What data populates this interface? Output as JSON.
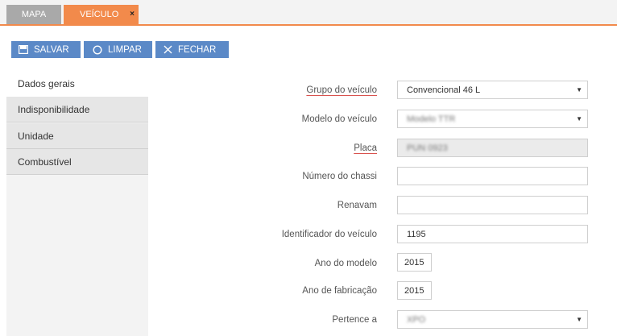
{
  "tabs": [
    {
      "label": "MAPA"
    },
    {
      "label": "VEÍCULO",
      "close": "×"
    }
  ],
  "toolbar": {
    "save_label": "SALVAR",
    "clear_label": "LIMPAR",
    "close_label": "FECHAR"
  },
  "sidebar": {
    "items": [
      {
        "label": "Dados gerais"
      },
      {
        "label": "Indisponibilidade"
      },
      {
        "label": "Unidade"
      },
      {
        "label": "Combustível"
      }
    ]
  },
  "form": {
    "grupo": {
      "label": "Grupo do veículo",
      "value": "Convencional 46 L"
    },
    "modelo": {
      "label": "Modelo do veículo",
      "value": "Modelo TTR"
    },
    "placa": {
      "label": "Placa",
      "value": "PUN 0923"
    },
    "chassi": {
      "label": "Número do chassi",
      "value": ""
    },
    "renavam": {
      "label": "Renavam",
      "value": ""
    },
    "identificador": {
      "label": "Identificador do veículo",
      "value": "1195"
    },
    "ano_modelo": {
      "label": "Ano do modelo",
      "value": "2015"
    },
    "ano_fabricacao": {
      "label": "Ano de fabricação",
      "value": "2015"
    },
    "pertence": {
      "label": "Pertence a",
      "value": "XPO"
    }
  },
  "colors": {
    "accent": "#f28a4b",
    "button": "#5b89c7"
  }
}
